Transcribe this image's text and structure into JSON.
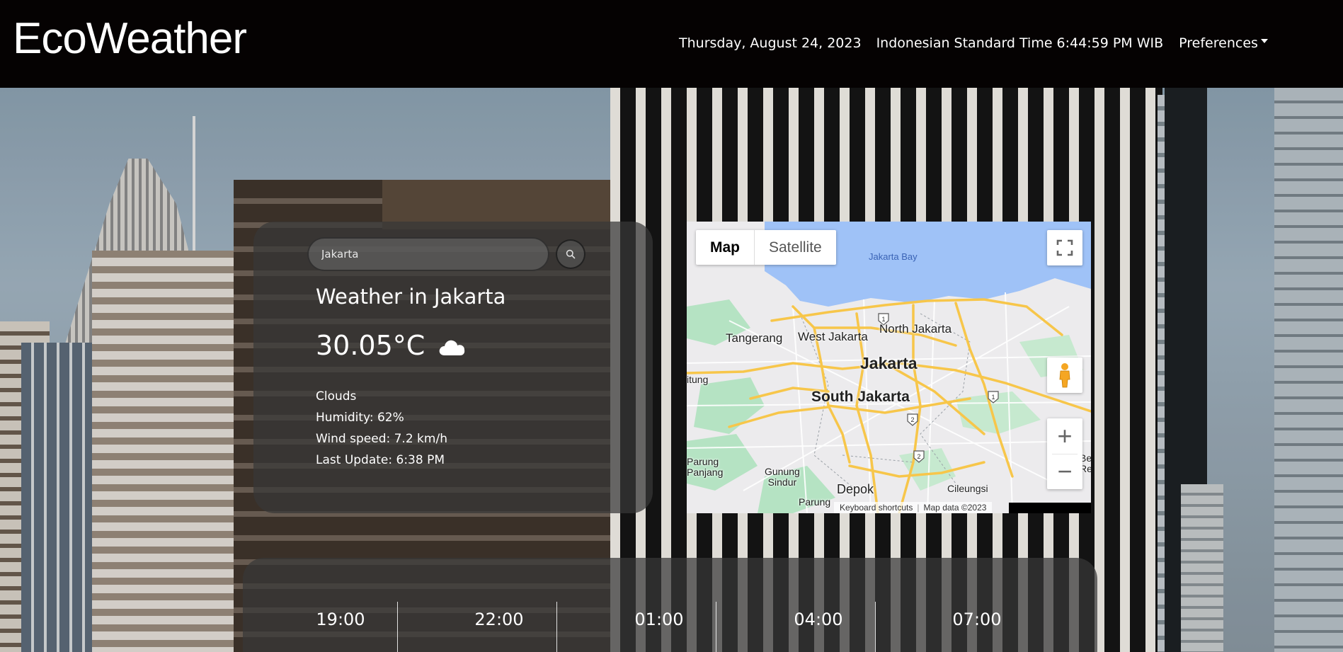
{
  "header": {
    "logo": "EcoWeather",
    "date": "Thursday, August 24, 2023",
    "time": "Indonesian Standard Time 6:44:59 PM WIB",
    "preferences_label": "Preferences"
  },
  "search": {
    "value": "Jakarta",
    "placeholder": "Jakarta"
  },
  "weather": {
    "title": "Weather in Jakarta",
    "temperature": "30.05°C",
    "icon": "cloud-icon",
    "description": "Clouds",
    "humidity": "Humidity: 62%",
    "wind": "Wind speed: 7.2 km/h",
    "last_update": "Last Update: 6:38 PM"
  },
  "map": {
    "type_map": "Map",
    "type_satellite": "Satellite",
    "labels": {
      "bay": "Jakarta Bay",
      "tangerang": "Tangerang",
      "west_jakarta": "West Jakarta",
      "north_jakarta": "North Jakarta",
      "jakarta": "Jakarta",
      "south_jakarta": "South Jakarta",
      "depok": "Depok",
      "cileungsi": "Cileungsi",
      "gunung_sindur": "Gunung\nSindur",
      "parung_panjang": "Parung\nPanjang",
      "parung": "Parung",
      "itung": "itung",
      "be_re": "Be\nRe"
    },
    "shields": [
      "1",
      "1",
      "2",
      "2"
    ],
    "zoom_in": "+",
    "zoom_out": "−",
    "keyboard_shortcuts": "Keyboard shortcuts",
    "map_data": "Map data ©2023"
  },
  "forecast": {
    "hours": [
      "19:00",
      "22:00",
      "01:00",
      "04:00",
      "07:00"
    ]
  },
  "colors": {
    "header_bg": "#050202",
    "card_bg": "rgba(55,55,55,0.72)",
    "water": "#9fc2f7",
    "road": "#f7c64a",
    "park": "#b5e3c3"
  }
}
